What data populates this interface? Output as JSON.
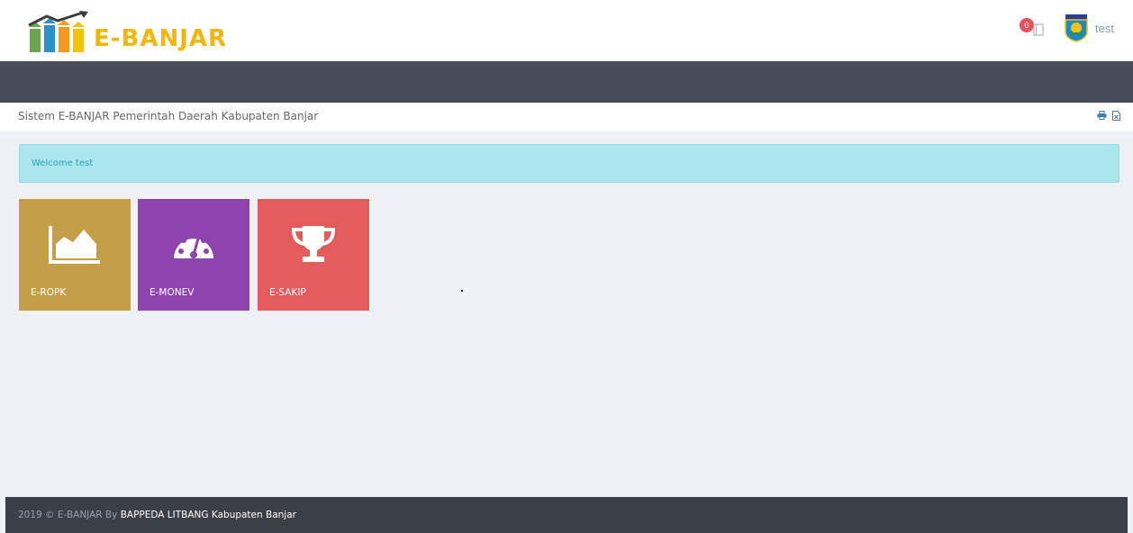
{
  "header": {
    "logo_text": "E-BANJAR",
    "notification_count": "0",
    "username": "test"
  },
  "pagebar": {
    "title": "Sistem E-BANJAR Pemerintah Daerah Kabupaten Banjar"
  },
  "alert": {
    "text": "Welcome test"
  },
  "tiles": [
    {
      "label": "E-ROPK",
      "icon": "area-chart-icon",
      "color": "#c49f47"
    },
    {
      "label": "E-MONEV",
      "icon": "dashboard-icon",
      "color": "#8e44ad"
    },
    {
      "label": "E-SAKIP",
      "icon": "trophy-icon",
      "color": "#e35b5a"
    }
  ],
  "footer": {
    "prefix": "2019 © E-BANJAR By",
    "link": "BAPPEDA LITBANG Kabupaten Banjar"
  },
  "colors": {
    "navbar": "#464c57",
    "footer": "#3a3f48",
    "alert_bg": "#abe5ee",
    "logo_gold": "#f2b705"
  }
}
